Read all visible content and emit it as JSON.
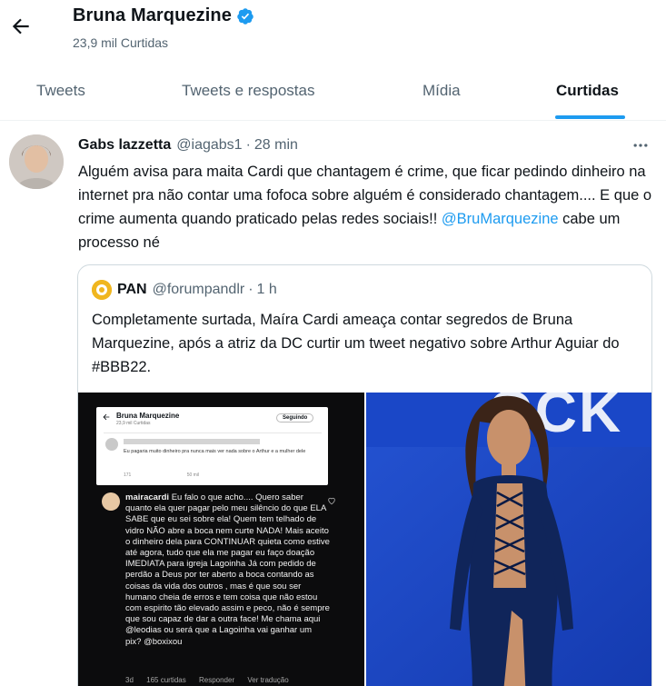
{
  "header": {
    "title": "Bruna Marquezine",
    "subtitle": "23,9 mil Curtidas"
  },
  "tabs": [
    {
      "label": "Tweets"
    },
    {
      "label": "Tweets e respostas"
    },
    {
      "label": "Mídia"
    },
    {
      "label": "Curtidas"
    }
  ],
  "tweet": {
    "name": "Gabs lazzetta",
    "handle": "@iagabs1",
    "separator": "·",
    "time": "28 min",
    "text_before": "Alguém avisa para maita Cardi que chantagem é crime, que ficar pedindo dinheiro na internet pra não contar uma fofoca sobre alguém é considerado chantagem.... E que o crime aumenta quando praticado pelas redes sociais!! ",
    "mention": "@BruMarquezine",
    "text_after": " cabe um processo né"
  },
  "quote": {
    "name": "PAN",
    "handle": "@forumpandlr",
    "separator": "·",
    "time": "1 h",
    "text": "Completamente surtada, Maíra Cardi ameaça contar segredos de Bruna Marquezine, após a atriz da DC curtir um tweet negativo sobre Arthur Aguiar do #BBB22."
  },
  "media_left": {
    "inner_title": "Bruna Marquezine",
    "inner_subtitle": "23,9 mil Curtidas",
    "inner_follow": "Seguindo",
    "inner_tweet_text": "Eu pagaria muito dinheiro pra nunca mais ver nada sobre o Arthur e a mulher dele",
    "inner_icons": [
      "171",
      "50 mil"
    ],
    "comment_user": "mairacardi",
    "comment_text": "Eu falo o que acho.... Quero saber quanto ela quer pagar pelo meu silêncio do que ELA SABE que eu sei sobre ela! Quem tem telhado de vidro NÃO abre a boca nem curte NADA! Mais aceito o dinheiro dela para CONTINUAR quieta como estive até agora, tudo que ela me pagar eu faço doação IMEDIATA para igreja Lagoinha Já com pedido de perdão a Deus por ter aberto a boca contando as coisas da vida dos outros , mas é que sou ser humano cheia de erros e tem coisa que não estou com espirito tão elevado assim e peco, não é sempre que sou capaz de dar a outra face! Me chama aqui @leodias ou será que a Lagoinha vai ganhar um pix? @boxixou",
    "footer": [
      "3d",
      "165 curtidas",
      "Responder",
      "Ver tradução"
    ]
  },
  "media_right": {
    "backdrop_letters": "OCK"
  },
  "colors": {
    "accent": "#1d9bf0",
    "text_primary": "#0f1419",
    "text_secondary": "#536471",
    "border": "#cfd9de"
  }
}
